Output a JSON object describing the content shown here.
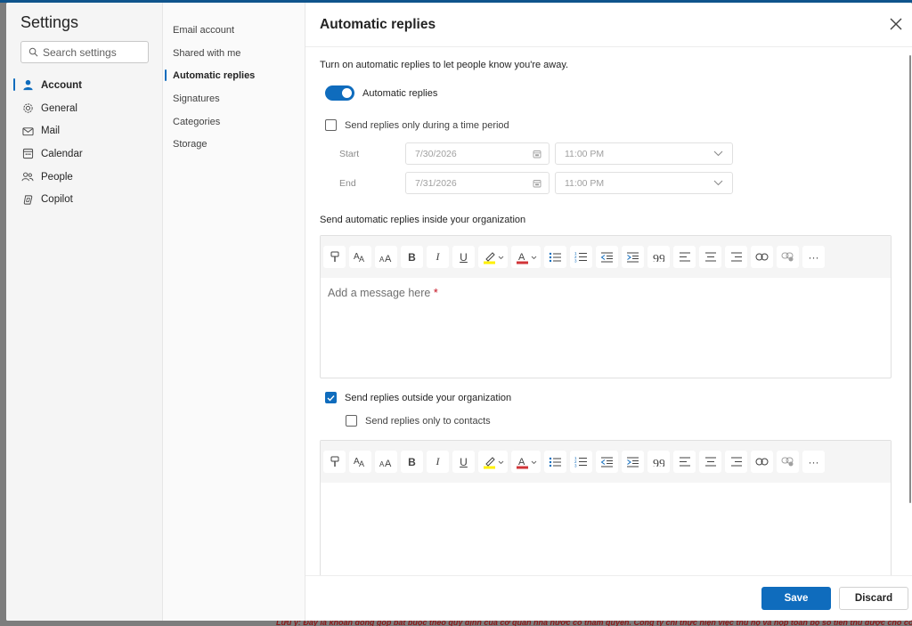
{
  "settings": {
    "title": "Settings",
    "search_placeholder": "Search settings",
    "nav": [
      {
        "label": "Account",
        "icon": "person-icon",
        "active": true
      },
      {
        "label": "General",
        "icon": "gear-icon"
      },
      {
        "label": "Mail",
        "icon": "mail-icon"
      },
      {
        "label": "Calendar",
        "icon": "calendar-icon"
      },
      {
        "label": "People",
        "icon": "people-icon"
      },
      {
        "label": "Copilot",
        "icon": "copilot-icon"
      }
    ],
    "subnav": [
      {
        "label": "Email account"
      },
      {
        "label": "Shared with me"
      },
      {
        "label": "Automatic replies",
        "active": true
      },
      {
        "label": "Signatures"
      },
      {
        "label": "Categories"
      },
      {
        "label": "Storage"
      }
    ]
  },
  "panel": {
    "title": "Automatic replies",
    "intro": "Turn on automatic replies to let people know you're away.",
    "toggle_label": "Automatic replies",
    "toggle_on": true,
    "time_period_label": "Send replies only during a time period",
    "time_period_checked": false,
    "start": {
      "label": "Start",
      "date": "7/30/2026",
      "time": "11:00 PM"
    },
    "end": {
      "label": "End",
      "date": "7/31/2026",
      "time": "11:00 PM"
    },
    "inside_label": "Send automatic replies inside your organization",
    "message_placeholder": "Add a message here",
    "required_mark": "*",
    "outside_label": "Send replies outside your organization",
    "outside_checked": true,
    "contacts_label": "Send replies only to contacts",
    "contacts_checked": false
  },
  "toolbar": {
    "italic": "I",
    "underline": "U",
    "bold": "B",
    "more": "···"
  },
  "footer": {
    "save_label": "Save",
    "discard_label": "Discard"
  },
  "colors": {
    "accent": "#0f6cbd",
    "highlight": "#fff100",
    "font_color": "#d13438"
  },
  "backdrop_note": "Lưu ý: Đây là khoản đóng góp bắt buộc theo quy định của cơ quan nhà nước có thẩm quyền. Công ty chỉ thực hiện việc thu hộ và nộp toàn bộ số tiền thu được cho cơ"
}
